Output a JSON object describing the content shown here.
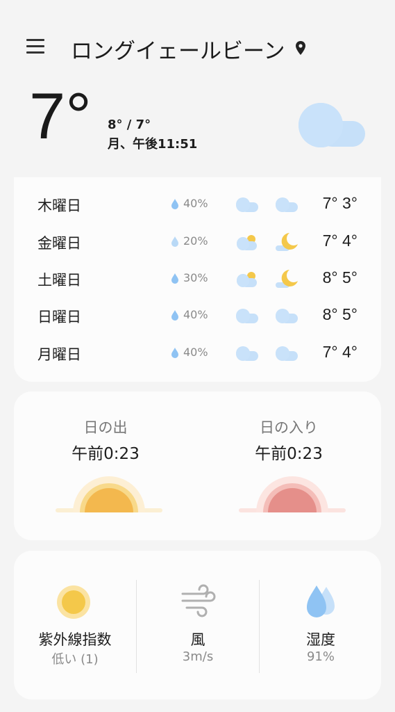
{
  "header": {
    "city": "ロングイェールビーン",
    "menu_icon": "hamburger-menu-icon",
    "location_icon": "location-pin-icon"
  },
  "current": {
    "temperature": "7°",
    "high_low": "8° / 7°",
    "datetime": "月、午後11:51",
    "condition_icon": "cloud-icon"
  },
  "forecast": [
    {
      "day": "木曜日",
      "precip": "40%",
      "day_icon": "cloud-icon",
      "night_icon": "cloud-icon",
      "temps": "7° 3°"
    },
    {
      "day": "金曜日",
      "precip": "20%",
      "day_icon": "partly-sunny-icon",
      "night_icon": "partly-cloudy-night-icon",
      "temps": "7° 4°"
    },
    {
      "day": "土曜日",
      "precip": "30%",
      "day_icon": "partly-sunny-icon",
      "night_icon": "partly-cloudy-night-icon",
      "temps": "8° 5°"
    },
    {
      "day": "日曜日",
      "precip": "40%",
      "day_icon": "cloud-icon",
      "night_icon": "cloud-icon",
      "temps": "8° 5°"
    },
    {
      "day": "月曜日",
      "precip": "40%",
      "day_icon": "cloud-icon",
      "night_icon": "cloud-icon",
      "temps": "7° 4°"
    }
  ],
  "sun": {
    "sunrise_label": "日の出",
    "sunrise_time": "午前0:23",
    "sunset_label": "日の入り",
    "sunset_time": "午前0:23"
  },
  "details": {
    "uv_label": "紫外線指数",
    "uv_value": "低い (1)",
    "wind_label": "風",
    "wind_value": "3m/s",
    "humidity_label": "湿度",
    "humidity_value": "91%"
  },
  "colors": {
    "cloud": "#c6e0f9",
    "sun": "#f4c84a",
    "sunrise": "#f3b84e",
    "sunset": "#e58f8a",
    "drop": "#8fc3f3"
  }
}
